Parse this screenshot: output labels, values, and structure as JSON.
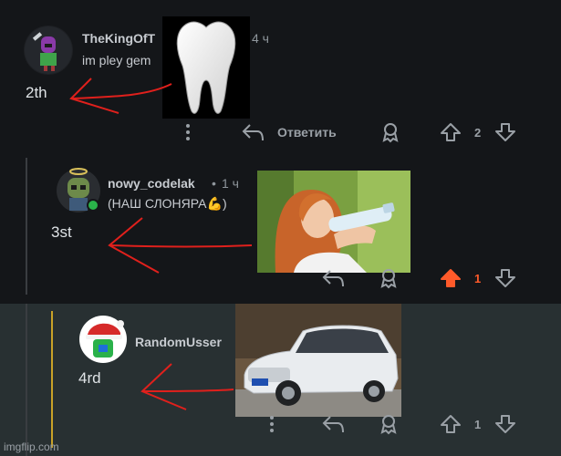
{
  "comments": [
    {
      "username": "TheKingOfT",
      "time": "4 ч",
      "text": "im pley gem",
      "annotation": "2th",
      "reply_label": "Ответить",
      "votes": "2"
    },
    {
      "username": "nowy_codelak",
      "separator": "•",
      "time": "1 ч",
      "text": "(НАШ СЛОНЯРА💪)",
      "annotation": "3st",
      "votes": "1"
    },
    {
      "username": "RandomUsser",
      "annotation": "4rd",
      "votes": "1"
    }
  ],
  "watermark": "imgflip.com",
  "colors": {
    "upvote_active": "#ff5a2a",
    "annotation_arrow": "#e0201c",
    "thread_gold": "#c9a227"
  }
}
